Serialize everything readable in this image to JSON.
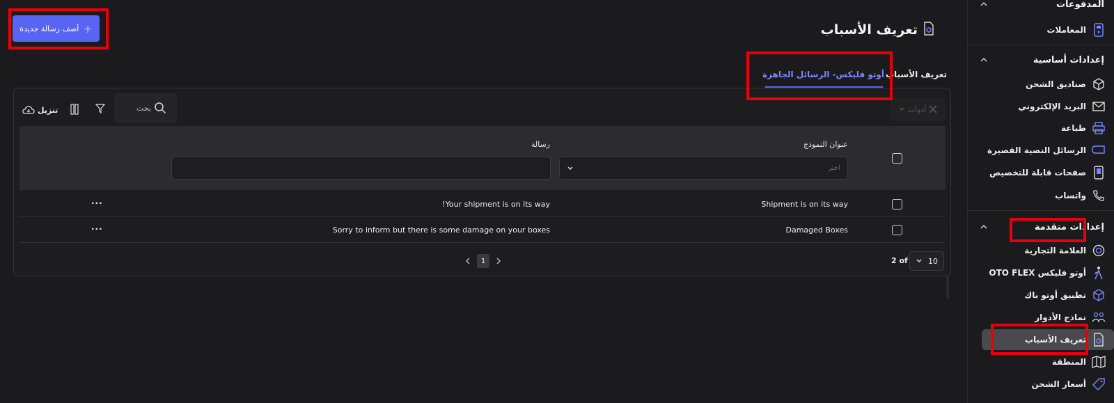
{
  "sidebar": {
    "top_cut_label": "المدفوعات",
    "transactions": "المعاملات",
    "basic_settings": "إعدادات أساسية",
    "basic_items": [
      {
        "label": "صناديق الشحن",
        "icon": "box-icon"
      },
      {
        "label": "البريد الإلكتروني",
        "icon": "mail-icon"
      },
      {
        "label": "طباعة",
        "icon": "printer-icon"
      },
      {
        "label": "الرسائل النصية القصيرة",
        "icon": "sms-icon"
      },
      {
        "label": "صفحات قابلة للتخصيص",
        "icon": "phone-page-icon"
      },
      {
        "label": "واتساب",
        "icon": "phone-icon"
      }
    ],
    "advanced_settings": "إعدادات متقدمة",
    "advanced_items": [
      {
        "label": "العلامة التجارية",
        "icon": "brand-icon"
      },
      {
        "label": "أوتو فليكس OTO FLEX",
        "icon": "courier-icon"
      },
      {
        "label": "تطبيق أوتو باك",
        "icon": "package-icon"
      },
      {
        "label": "نماذج الأدوار",
        "icon": "users-icon"
      },
      {
        "label": "تعريف الأسباب",
        "icon": "document-gear-icon"
      },
      {
        "label": "المنطقة",
        "icon": "map-icon"
      },
      {
        "label": "أسعار الشحن",
        "icon": "tag-icon"
      }
    ]
  },
  "header": {
    "title": "تعريف الأسباب",
    "add_button": "أضف رسالة جديدة"
  },
  "tabs": [
    {
      "label": "تعريف الأسباب",
      "active": false
    },
    {
      "label": "أوتو فليكس- الرسائل الجاهزة",
      "active": true
    }
  ],
  "toolbar": {
    "search_placeholder": "بحث",
    "tools_label": "أدوات",
    "download_label": "تنزيل"
  },
  "table": {
    "columns": [
      "عنوان النموذج",
      "رسالة"
    ],
    "filter_placeholder": "اختر",
    "rows": [
      {
        "title": "Shipment is on its way",
        "message": "!Your shipment is on its way"
      },
      {
        "title": "Damaged Boxes",
        "message": "Sorry to inform but there is some damage on your boxes"
      }
    ],
    "more_label": "..."
  },
  "pagination": {
    "current_page": "1",
    "page_count_label": "2 of",
    "page_size": "10"
  },
  "colors": {
    "accent": "#5865f2",
    "background": "#1b1b1d",
    "annotation": "#e8000b"
  }
}
